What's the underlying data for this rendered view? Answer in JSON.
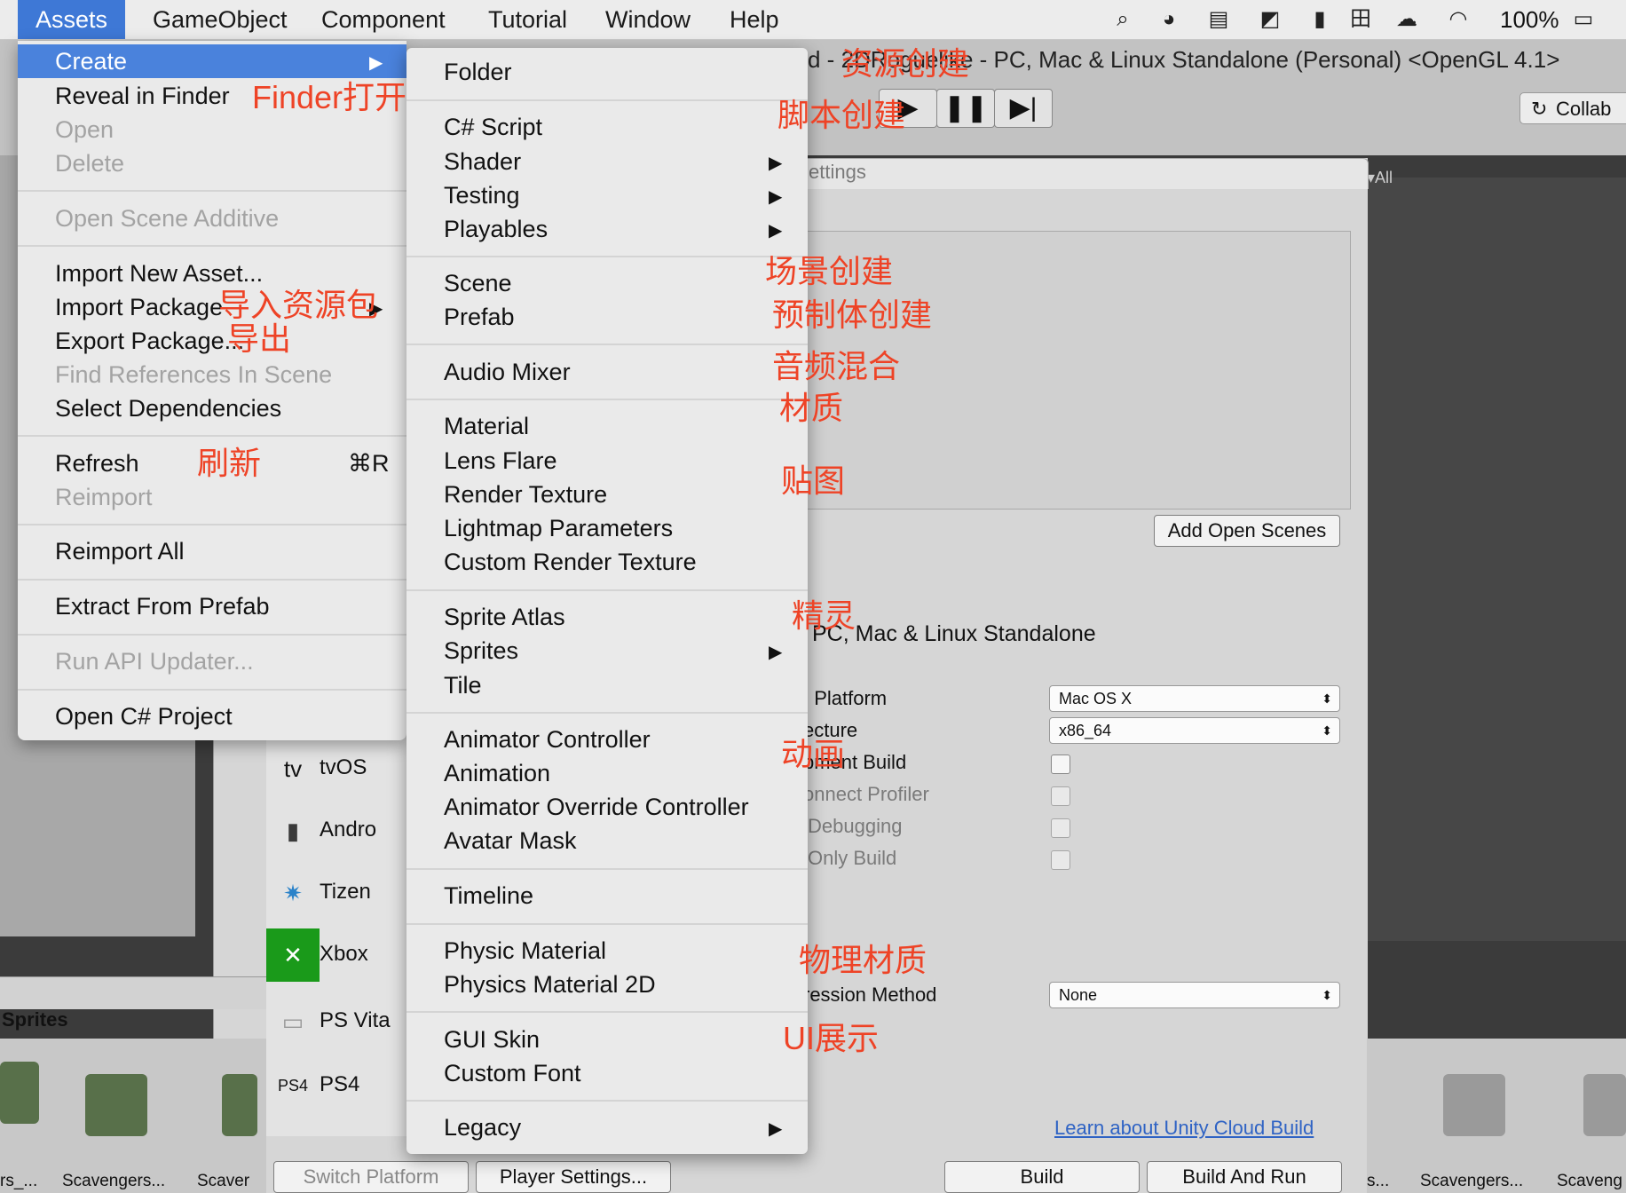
{
  "menubar": {
    "items": [
      "Assets",
      "GameObject",
      "Component",
      "Tutorial",
      "Window",
      "Help"
    ],
    "battery": "100%"
  },
  "window": {
    "title": "d - 2DRoguelike - PC, Mac & Linux Standalone (Personal) <OpenGL 4.1>",
    "collab": "Collab",
    "play_icons": [
      "play-icon",
      "pause-icon",
      "step-icon"
    ]
  },
  "build_settings": {
    "tab_fragment": "ettings",
    "search_fragment": "All",
    "add_open_scenes": "Add Open Scenes",
    "platform_header": "PC, Mac & Linux Standalone",
    "labels": {
      "target_platform": ": Platform",
      "architecture": "ecture",
      "dev_build": "pment Build",
      "connect_profiler": "onnect Profiler",
      "debugging": "Debugging",
      "scripts_only": "Only Build",
      "compression": "ression Method"
    },
    "target_platform_value": "Mac OS X",
    "architecture_value": "x86_64",
    "compression_value": "None",
    "learn_link": "Learn about Unity Cloud Build",
    "switch_platform": "Switch Platform",
    "player_settings": "Player Settings...",
    "build": "Build",
    "build_and_run": "Build And Run",
    "platforms": [
      "tvOS",
      "Andro",
      "Tizen",
      "Xbox",
      "PS Vita",
      "PS4"
    ]
  },
  "project": {
    "sprites_label": "Sprites",
    "thumbnails": [
      "rs_...",
      "Scavengers...",
      "Scaver",
      "s...",
      "Scavengers...",
      "Scaveng"
    ]
  },
  "assets_menu": {
    "create": "Create",
    "reveal_in_finder": "Reveal in Finder",
    "open": "Open",
    "delete": "Delete",
    "open_scene_additive": "Open Scene Additive",
    "import_new_asset": "Import New Asset...",
    "import_package": "Import Package",
    "export_package": "Export Package...",
    "find_references": "Find References In Scene",
    "select_dependencies": "Select Dependencies",
    "refresh": "Refresh",
    "refresh_shortcut": "⌘R",
    "reimport": "Reimport",
    "reimport_all": "Reimport All",
    "extract_from_prefab": "Extract From Prefab",
    "run_api_updater": "Run API Updater...",
    "open_csharp_project": "Open C# Project"
  },
  "create_menu": {
    "folder": "Folder",
    "csharp_script": "C# Script",
    "shader": "Shader",
    "testing": "Testing",
    "playables": "Playables",
    "scene": "Scene",
    "prefab": "Prefab",
    "audio_mixer": "Audio Mixer",
    "material": "Material",
    "lens_flare": "Lens Flare",
    "render_texture": "Render Texture",
    "lightmap_parameters": "Lightmap Parameters",
    "custom_render_texture": "Custom Render Texture",
    "sprite_atlas": "Sprite Atlas",
    "sprites": "Sprites",
    "tile": "Tile",
    "animator_controller": "Animator Controller",
    "animation": "Animation",
    "animator_override_controller": "Animator Override Controller",
    "avatar_mask": "Avatar Mask",
    "timeline": "Timeline",
    "physic_material": "Physic Material",
    "physics_material_2d": "Physics Material 2D",
    "gui_skin": "GUI Skin",
    "custom_font": "Custom Font",
    "legacy": "Legacy"
  },
  "annotations": {
    "finder_open": "Finder打开",
    "asset_create": "资源创建",
    "script_create": "脚本创建",
    "scene_create": "场景创建",
    "prefab_create": "预制体创建",
    "audio_mixer": "音频混合",
    "material": "材质",
    "texture": "贴图",
    "sprite": "精灵",
    "animation": "动画",
    "physics_material": "物理材质",
    "ui_display": "UI展示",
    "import_package": "导入资源包",
    "export": "导出",
    "refresh": "刷新"
  },
  "colors": {
    "menu_highlight": "#4a82dc",
    "annotation": "#ee4326",
    "link": "#2f63c4"
  }
}
